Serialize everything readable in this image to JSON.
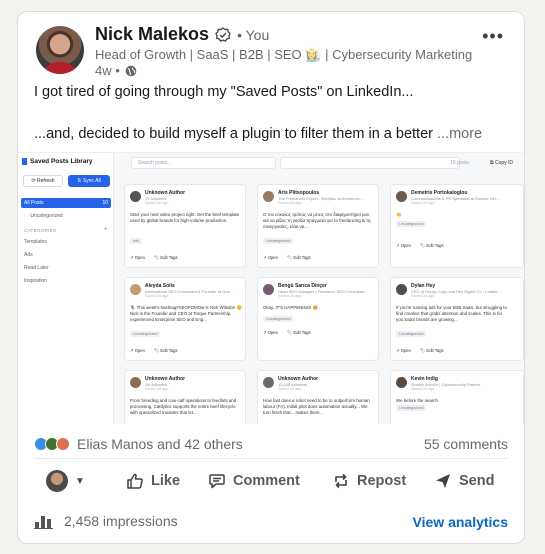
{
  "post": {
    "author": {
      "name": "Nick Malekos",
      "degree": "• You",
      "headline": "Head of Growth | SaaS | B2B | SEO 👩‍🌾 | Cybersecurity Marketing",
      "time": "4w •"
    },
    "more_icon": "ellipsis-icon",
    "text_line1": "I got tired of going through my \"Saved Posts\" on LinkedIn...",
    "text_line2": "...and, decided to build myself a plugin to filter them in a better",
    "see_more": "...more"
  },
  "screenshot": {
    "app_title": "Saved Posts Library",
    "refresh": "Refresh",
    "sync": "Sync All",
    "all_posts": "All Posts",
    "all_posts_count": "10",
    "uncategorized": "Uncategorized",
    "categories_label": "CATEGORIES",
    "categories": [
      "Templates",
      "Ads",
      "Read Later",
      "Inspiration"
    ],
    "search_placeholder": "Search posts...",
    "posts_count": "10 posts",
    "selected": "Selected",
    "copy": "Copy ID",
    "cards": [
      {
        "name": "Unknown Author",
        "sub": "75 followers",
        "date": "Saved 2d ago",
        "text": "Start your next video project right. Get the brief template used by global brands for high-volume production.",
        "tag": "ads",
        "open": "Open",
        "edit": "Edit Tags"
      },
      {
        "name": "Aris Plitsopoulos",
        "sub": "The Freelancer Expert - Βοηθάω το freelancer...",
        "date": "Saved 2d ago",
        "text": "Ο πιο εύκολος τρόπος να μπεις στο διαφημιστήριο μου και να ρίξεις τη γκρίζα πράγματα για το freelancing & τις συνεργασίες, είναι να...",
        "tag": "Uncategorized",
        "open": "Open",
        "edit": "Edit Tags"
      },
      {
        "name": "Demetris Portokaloglou",
        "sub": "Communications & PR Specialist at Sunrise Hel...",
        "date": "Saved 2d ago",
        "text": "👏",
        "tag": "Uncategorized",
        "open": "Open",
        "edit": "Edit Tags"
      },
      {
        "name": "Aleyda Solis",
        "sub": "International SEO Consultant & Founder at Orai...",
        "date": "Saved 2d ago",
        "text": "🎙️ This week's hashtag#SEOFOMOw is Nick Wilsdon 🙂 Nick is the Founder and CEO at Torque Partnership, experienced Enterprise SEO and Eng...",
        "tag": "Uncategorized",
        "open": "Open",
        "edit": "Edit Tags"
      },
      {
        "name": "Bengü Sarıca Dinçer",
        "sub": "Head SEO Manager • Freelance SEO Consultan...",
        "date": "Saved 2d ago",
        "text": "Okay, IT'S HAPPENING! 🥹",
        "tag": "Uncategorized",
        "open": "Open",
        "edit": "Edit Tags"
      },
      {
        "name": "Dylan Hey",
        "sub": "CEO of Hoppy Copy and Hey Digital Co - Leadin...",
        "date": "Saved 2d ago",
        "text": "If you're running ads for your B2B SaaS, but struggling to find creative that grabs attention and scales. This is for you SaaS brands are growing...",
        "tag": "Uncategorized",
        "open": "Open",
        "edit": "Edit Tags"
      },
      {
        "name": "Unknown Author",
        "sub": "On followers",
        "date": "Saved 2d ago",
        "text": "From breeding and cow-calf operations to feedlots and processing, Cattlytics supports the entire beef lifecycle with specialized modules that let...",
        "tag": "",
        "open": "Open",
        "edit": "Edit Tags"
      },
      {
        "name": "Unknown Author",
        "sub": "13,106 followers",
        "date": "Saved 2d ago",
        "text": "How fast does a robot need to be to outperform human labour (FA). Initial pilot does automation actually... We turn finish that... makes them...",
        "tag": "",
        "open": "Open",
        "edit": "Edit Tags"
      },
      {
        "name": "Kevin Indig",
        "sub": "Growth Advisor | Cybersecurity Partner",
        "date": "Saved 2d ago",
        "text": "We before the search",
        "tag": "Uncategorized",
        "open": "Open",
        "edit": "Edit Tags"
      }
    ]
  },
  "social": {
    "reactions": "Elias Manos and 42 others",
    "comments": "55 comments"
  },
  "actions": {
    "like": "Like",
    "comment": "Comment",
    "repost": "Repost",
    "send": "Send"
  },
  "footer": {
    "impressions": "2,458 impressions",
    "analytics": "View analytics"
  },
  "colors": {
    "linkedin_blue": "#0a66c2",
    "plugin_accent": "#2563eb",
    "reaction_like": "#378fe9",
    "reaction_celebrate": "#44712e",
    "reaction_love": "#df704d"
  }
}
